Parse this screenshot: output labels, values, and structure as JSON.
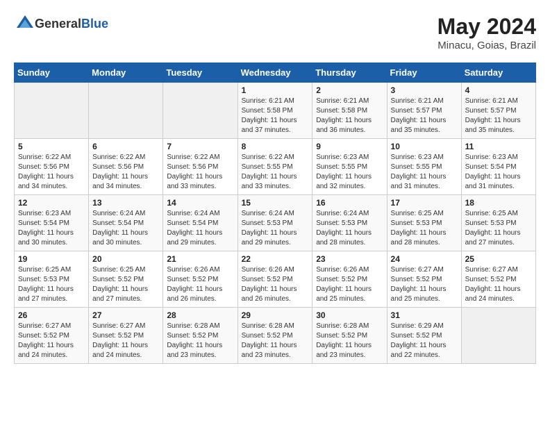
{
  "header": {
    "logo_general": "General",
    "logo_blue": "Blue",
    "month_year": "May 2024",
    "location": "Minacu, Goias, Brazil"
  },
  "days_of_week": [
    "Sunday",
    "Monday",
    "Tuesday",
    "Wednesday",
    "Thursday",
    "Friday",
    "Saturday"
  ],
  "weeks": [
    [
      {
        "day": "",
        "info": ""
      },
      {
        "day": "",
        "info": ""
      },
      {
        "day": "",
        "info": ""
      },
      {
        "day": "1",
        "info": "Sunrise: 6:21 AM\nSunset: 5:58 PM\nDaylight: 11 hours\nand 37 minutes."
      },
      {
        "day": "2",
        "info": "Sunrise: 6:21 AM\nSunset: 5:58 PM\nDaylight: 11 hours\nand 36 minutes."
      },
      {
        "day": "3",
        "info": "Sunrise: 6:21 AM\nSunset: 5:57 PM\nDaylight: 11 hours\nand 35 minutes."
      },
      {
        "day": "4",
        "info": "Sunrise: 6:21 AM\nSunset: 5:57 PM\nDaylight: 11 hours\nand 35 minutes."
      }
    ],
    [
      {
        "day": "5",
        "info": "Sunrise: 6:22 AM\nSunset: 5:56 PM\nDaylight: 11 hours\nand 34 minutes."
      },
      {
        "day": "6",
        "info": "Sunrise: 6:22 AM\nSunset: 5:56 PM\nDaylight: 11 hours\nand 34 minutes."
      },
      {
        "day": "7",
        "info": "Sunrise: 6:22 AM\nSunset: 5:56 PM\nDaylight: 11 hours\nand 33 minutes."
      },
      {
        "day": "8",
        "info": "Sunrise: 6:22 AM\nSunset: 5:55 PM\nDaylight: 11 hours\nand 33 minutes."
      },
      {
        "day": "9",
        "info": "Sunrise: 6:23 AM\nSunset: 5:55 PM\nDaylight: 11 hours\nand 32 minutes."
      },
      {
        "day": "10",
        "info": "Sunrise: 6:23 AM\nSunset: 5:55 PM\nDaylight: 11 hours\nand 31 minutes."
      },
      {
        "day": "11",
        "info": "Sunrise: 6:23 AM\nSunset: 5:54 PM\nDaylight: 11 hours\nand 31 minutes."
      }
    ],
    [
      {
        "day": "12",
        "info": "Sunrise: 6:23 AM\nSunset: 5:54 PM\nDaylight: 11 hours\nand 30 minutes."
      },
      {
        "day": "13",
        "info": "Sunrise: 6:24 AM\nSunset: 5:54 PM\nDaylight: 11 hours\nand 30 minutes."
      },
      {
        "day": "14",
        "info": "Sunrise: 6:24 AM\nSunset: 5:54 PM\nDaylight: 11 hours\nand 29 minutes."
      },
      {
        "day": "15",
        "info": "Sunrise: 6:24 AM\nSunset: 5:53 PM\nDaylight: 11 hours\nand 29 minutes."
      },
      {
        "day": "16",
        "info": "Sunrise: 6:24 AM\nSunset: 5:53 PM\nDaylight: 11 hours\nand 28 minutes."
      },
      {
        "day": "17",
        "info": "Sunrise: 6:25 AM\nSunset: 5:53 PM\nDaylight: 11 hours\nand 28 minutes."
      },
      {
        "day": "18",
        "info": "Sunrise: 6:25 AM\nSunset: 5:53 PM\nDaylight: 11 hours\nand 27 minutes."
      }
    ],
    [
      {
        "day": "19",
        "info": "Sunrise: 6:25 AM\nSunset: 5:53 PM\nDaylight: 11 hours\nand 27 minutes."
      },
      {
        "day": "20",
        "info": "Sunrise: 6:25 AM\nSunset: 5:52 PM\nDaylight: 11 hours\nand 27 minutes."
      },
      {
        "day": "21",
        "info": "Sunrise: 6:26 AM\nSunset: 5:52 PM\nDaylight: 11 hours\nand 26 minutes."
      },
      {
        "day": "22",
        "info": "Sunrise: 6:26 AM\nSunset: 5:52 PM\nDaylight: 11 hours\nand 26 minutes."
      },
      {
        "day": "23",
        "info": "Sunrise: 6:26 AM\nSunset: 5:52 PM\nDaylight: 11 hours\nand 25 minutes."
      },
      {
        "day": "24",
        "info": "Sunrise: 6:27 AM\nSunset: 5:52 PM\nDaylight: 11 hours\nand 25 minutes."
      },
      {
        "day": "25",
        "info": "Sunrise: 6:27 AM\nSunset: 5:52 PM\nDaylight: 11 hours\nand 24 minutes."
      }
    ],
    [
      {
        "day": "26",
        "info": "Sunrise: 6:27 AM\nSunset: 5:52 PM\nDaylight: 11 hours\nand 24 minutes."
      },
      {
        "day": "27",
        "info": "Sunrise: 6:27 AM\nSunset: 5:52 PM\nDaylight: 11 hours\nand 24 minutes."
      },
      {
        "day": "28",
        "info": "Sunrise: 6:28 AM\nSunset: 5:52 PM\nDaylight: 11 hours\nand 23 minutes."
      },
      {
        "day": "29",
        "info": "Sunrise: 6:28 AM\nSunset: 5:52 PM\nDaylight: 11 hours\nand 23 minutes."
      },
      {
        "day": "30",
        "info": "Sunrise: 6:28 AM\nSunset: 5:52 PM\nDaylight: 11 hours\nand 23 minutes."
      },
      {
        "day": "31",
        "info": "Sunrise: 6:29 AM\nSunset: 5:52 PM\nDaylight: 11 hours\nand 22 minutes."
      },
      {
        "day": "",
        "info": ""
      }
    ]
  ]
}
